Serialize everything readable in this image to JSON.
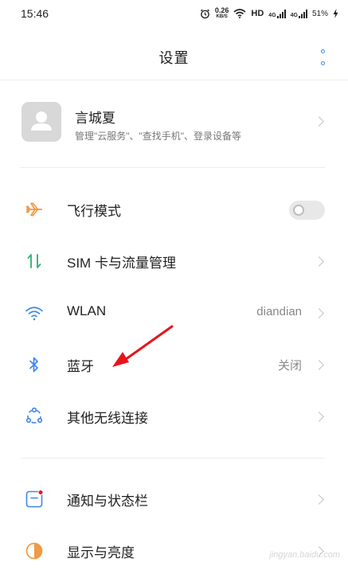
{
  "status_bar": {
    "time": "15:46",
    "net_speed_value": "0.26",
    "net_speed_unit": "KB/S",
    "hd_label": "HD",
    "signal_1": "4G",
    "signal_2": "4G",
    "battery": "51%"
  },
  "header": {
    "title": "设置"
  },
  "account": {
    "name": "言城夏",
    "subtitle": "管理\"云服务\"、\"查找手机\"、登录设备等"
  },
  "settings": {
    "airplane": {
      "label": "飞行模式",
      "enabled": false
    },
    "sim": {
      "label": "SIM 卡与流量管理"
    },
    "wlan": {
      "label": "WLAN",
      "value": "diandian"
    },
    "bluetooth": {
      "label": "蓝牙",
      "value": "关闭"
    },
    "other_wireless": {
      "label": "其他无线连接"
    },
    "notifications": {
      "label": "通知与状态栏"
    },
    "display": {
      "label": "显示与亮度"
    }
  },
  "colors": {
    "accent_blue": "#3f86f0",
    "airplane_orange": "#f09a44",
    "sim_green": "#36b37e",
    "annotation_red": "#e8141b"
  },
  "watermark": {
    "text": "jingyan.baidu.com"
  }
}
